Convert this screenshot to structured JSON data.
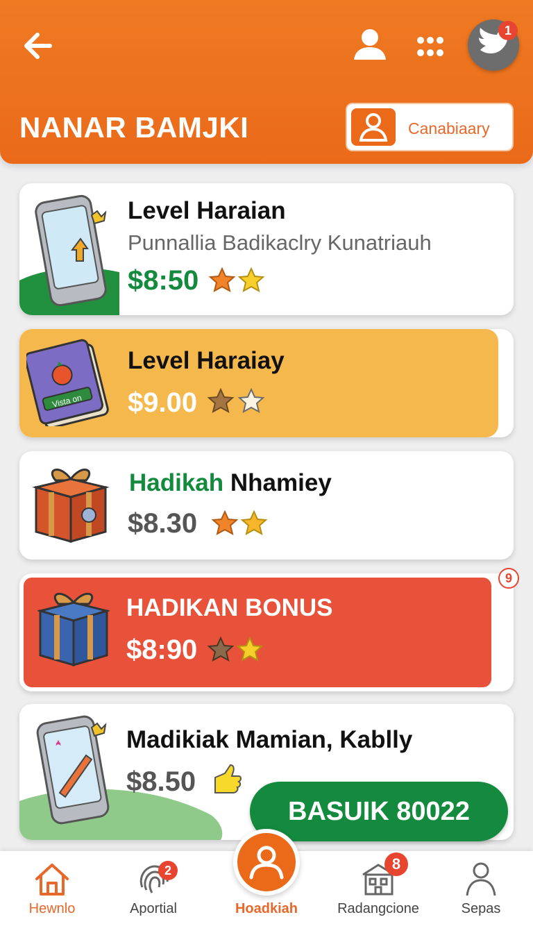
{
  "header": {
    "title": "NANAR BAMJKI",
    "avatar_badge": "1",
    "category_button_label": "Canabiaary"
  },
  "cards": [
    {
      "title": "Level Haraian",
      "subtitle": "Punnallia Badikaclry Kunatriauh",
      "price": "$8:50",
      "price_color": "#138a3e",
      "stars": 2,
      "thumb": "phone-icon"
    },
    {
      "title": "Level Haraiay",
      "price": "$9.00",
      "price_color": "#ffffff",
      "stars": 2,
      "thumb": "book-icon",
      "thumb_label": "Vista on"
    },
    {
      "title_accent": "Hadikah",
      "title_rest": "Nhamiey",
      "price": "$8.30",
      "price_color": "#555555",
      "stars": 2,
      "thumb": "gift-icon"
    },
    {
      "title": "HADIKAN BONUS",
      "price": "$8:90",
      "price_color": "#ffffff",
      "stars": 2,
      "thumb": "gift-icon",
      "badge": "9"
    },
    {
      "title": "Madikiak Mamian, Kablly",
      "price": "$8.50",
      "price_color": "#555555",
      "thumb": "phone-icon"
    }
  ],
  "fab": {
    "label": "BASUIK 80022"
  },
  "bottom_nav": [
    {
      "label": "Hewnlo",
      "icon": "home-icon",
      "color": "#e8672a"
    },
    {
      "label": "Aportial",
      "icon": "fingerprint-icon",
      "badge": "2"
    },
    {
      "label": "Hoadkiah",
      "icon": "user-icon",
      "color": "#e8672a"
    },
    {
      "label": "Radangcione",
      "icon": "building-icon",
      "badge": "8"
    },
    {
      "label": "Sepas",
      "icon": "person-icon"
    }
  ],
  "colors": {
    "brand": "#ea6a1a",
    "green": "#138a3e",
    "red": "#e84530"
  }
}
